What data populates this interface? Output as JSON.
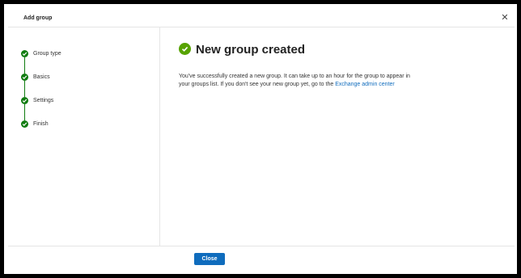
{
  "dialog": {
    "title": "Add group",
    "close_icon": "close-icon"
  },
  "steps": [
    {
      "label": "Group type",
      "status": "complete"
    },
    {
      "label": "Basics",
      "status": "complete"
    },
    {
      "label": "Settings",
      "status": "complete"
    },
    {
      "label": "Finish",
      "status": "complete"
    }
  ],
  "content": {
    "heading": "New group created",
    "message": "You've successfully created a new group. It can take up to an hour for the group to appear in your groups list. If you don't see your new group yet, go to the",
    "link_text": "Exchange admin center"
  },
  "footer": {
    "close_label": "Close"
  },
  "colors": {
    "step_complete": "#107c10",
    "success": "#57a300",
    "primary": "#0f6cbd"
  }
}
